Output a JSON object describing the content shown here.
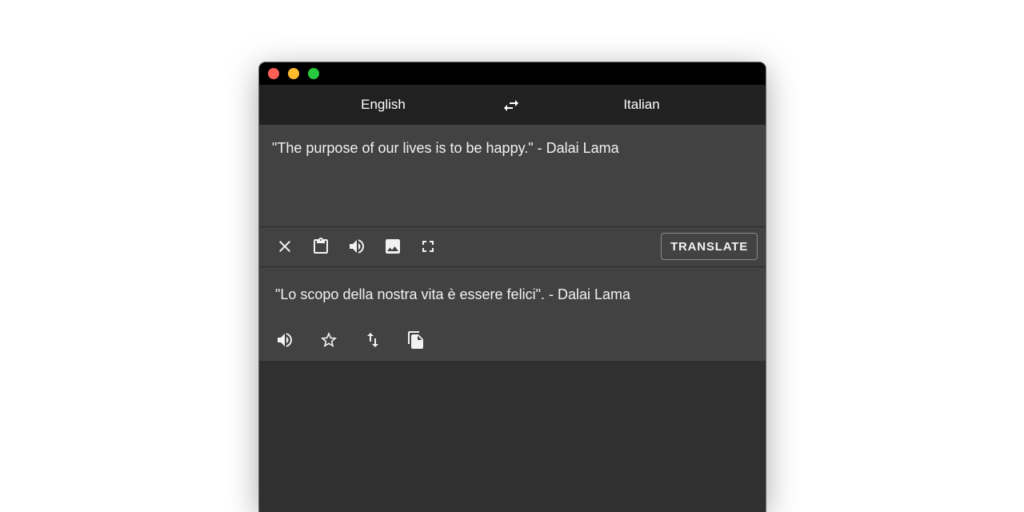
{
  "window": {
    "traffic_lights": {
      "close": "#fe5f57",
      "minimize": "#febc2e",
      "maximize": "#28c840"
    }
  },
  "languages": {
    "source": "English",
    "target": "Italian",
    "swap_icon": "swap-horizontal-icon"
  },
  "input": {
    "text": "\"The purpose of our lives is to be happy.\" - Dalai Lama"
  },
  "input_toolbar": {
    "icons": [
      "close-icon",
      "clipboard-icon",
      "speaker-icon",
      "image-icon",
      "fullscreen-icon"
    ],
    "translate_label": "TRANSLATE"
  },
  "output": {
    "text": "\"Lo scopo della nostra vita è essere felici\". - Dalai Lama",
    "icons": [
      "speaker-icon",
      "star-icon",
      "swap-vertical-icon",
      "copy-icon"
    ]
  },
  "colors": {
    "titlebar": "#000000",
    "langbar": "#212121",
    "panel": "#424242",
    "background": "#303030"
  }
}
